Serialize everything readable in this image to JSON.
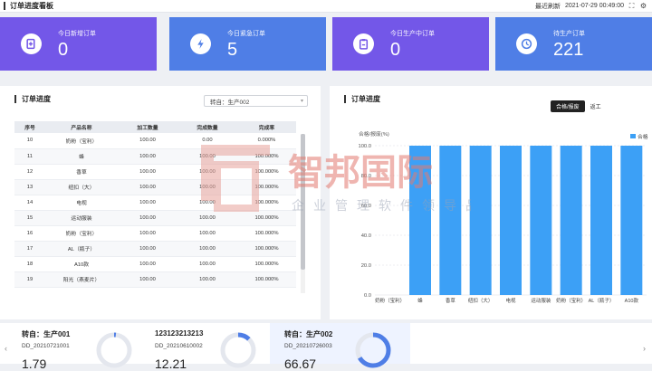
{
  "header": {
    "title": "订单进度看板",
    "refresh_label": "最近刷新",
    "refresh_time": "2021-07-29 00:49:00"
  },
  "cards": [
    {
      "label": "今日新增订单",
      "value": "0",
      "color": "#7357e8",
      "icon": "add-document-icon"
    },
    {
      "label": "今日紧急订单",
      "value": "5",
      "color": "#4f7ee6",
      "icon": "lightning-icon"
    },
    {
      "label": "今日生产中订单",
      "value": "0",
      "color": "#7357e8",
      "icon": "clipboard-icon"
    },
    {
      "label": "待生产订单",
      "value": "221",
      "color": "#4f7ee6",
      "icon": "clock-icon"
    }
  ],
  "progress_panel": {
    "title": "订单进度",
    "select_value": "转自：生产002",
    "columns": [
      "序号",
      "产品名称",
      "加工数量",
      "完成数量",
      "完成率"
    ],
    "rows": [
      [
        "10",
        "奶粉（宝利）",
        "100.00",
        "0.00",
        "0.000%"
      ],
      [
        "11",
        "蜂",
        "100.00",
        "100.00",
        "100.000%"
      ],
      [
        "12",
        "香草",
        "100.00",
        "100.00",
        "100.000%"
      ],
      [
        "13",
        "纽扣（大）",
        "100.00",
        "100.00",
        "100.000%"
      ],
      [
        "14",
        "电视",
        "100.00",
        "100.00",
        "100.000%"
      ],
      [
        "15",
        "运动服装",
        "100.00",
        "100.00",
        "100.000%"
      ],
      [
        "16",
        "奶粉（宝利）",
        "100.00",
        "100.00",
        "100.000%"
      ],
      [
        "17",
        "AL（瓶子）",
        "100.00",
        "100.00",
        "100.000%"
      ],
      [
        "18",
        "A10款",
        "100.00",
        "100.00",
        "100.000%"
      ],
      [
        "19",
        "阳光（燕麦片）",
        "100.00",
        "100.00",
        "100.000%"
      ]
    ]
  },
  "chart_panel": {
    "title": "订单进度",
    "btn_pass": "合格/报废",
    "btn_process": "返工",
    "ylabel": "合格/报废(%)",
    "legend": "合格"
  },
  "chart_data": {
    "type": "bar",
    "categories": [
      "奶粉（宝利）",
      "蜂",
      "香草",
      "纽扣（大）",
      "电视",
      "运动服装",
      "奶粉（宝利）",
      "AL（瓶子）",
      "A10款"
    ],
    "series": [
      {
        "name": "合格",
        "values": [
          0,
          100,
          100,
          100,
          100,
          100,
          100,
          100,
          100
        ],
        "color": "#3ca0f6"
      }
    ],
    "ylim": [
      0,
      100
    ],
    "yticks": [
      "0.0",
      "20.0",
      "40.0",
      "60.0",
      "80.0",
      "100.0"
    ],
    "grid": true,
    "legend_position": "top-right"
  },
  "bottom_cards": [
    {
      "title": "转自：生产001",
      "code": "DD_20210721001",
      "value": "1.79",
      "percent": 1.79
    },
    {
      "title": "123123213213",
      "code": "DD_20210610002",
      "value": "12.21",
      "percent": 12.21
    },
    {
      "title": "转自：生产002",
      "code": "DD_20210726003",
      "value": "66.67",
      "percent": 66.67
    }
  ],
  "watermark": {
    "name": "智邦国际",
    "slogan": "企业管理软件领导品牌"
  }
}
